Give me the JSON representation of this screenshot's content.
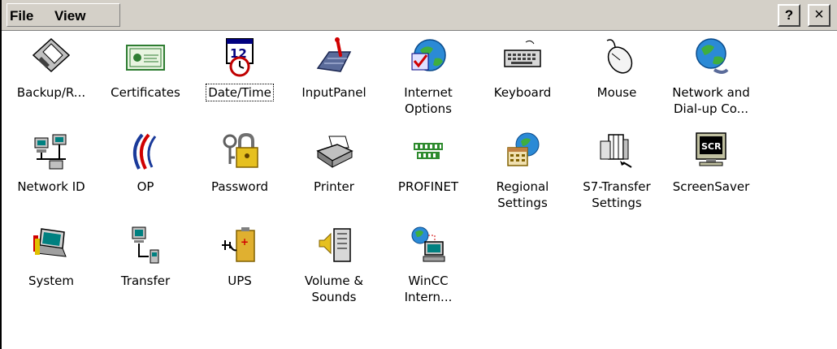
{
  "menubar": {
    "file": "File",
    "view": "View",
    "help": "?",
    "close": "×"
  },
  "items": [
    {
      "label": "Backup/R...",
      "icon": "floppy-disk-icon"
    },
    {
      "label": "Certificates",
      "icon": "certificate-icon"
    },
    {
      "label": "Date/Time",
      "icon": "calendar-clock-icon"
    },
    {
      "label": "InputPanel",
      "icon": "input-panel-keyboard-icon"
    },
    {
      "label": "Internet\nOptions",
      "icon": "globe-checkmark-icon"
    },
    {
      "label": "Keyboard",
      "icon": "keyboard-icon"
    },
    {
      "label": "Mouse",
      "icon": "mouse-icon"
    },
    {
      "label": "Network and\nDial-up Co...",
      "icon": "network-globe-icon"
    },
    {
      "label": "Network ID",
      "icon": "network-computers-icon"
    },
    {
      "label": "OP",
      "icon": "siemens-op-icon"
    },
    {
      "label": "Password",
      "icon": "keys-padlock-icon"
    },
    {
      "label": "Printer",
      "icon": "printer-icon"
    },
    {
      "label": "PROFINET",
      "icon": "profinet-icon"
    },
    {
      "label": "Regional\nSettings",
      "icon": "regional-calendar-globe-icon"
    },
    {
      "label": "S7-Transfer\nSettings",
      "icon": "s7-transfer-icon"
    },
    {
      "label": "ScreenSaver",
      "icon": "screensaver-monitor-icon"
    },
    {
      "label": "System",
      "icon": "laptop-system-icon"
    },
    {
      "label": "Transfer",
      "icon": "transfer-computer-device-icon"
    },
    {
      "label": "UPS",
      "icon": "ups-battery-icon"
    },
    {
      "label": "Volume &\nSounds",
      "icon": "speaker-icon"
    },
    {
      "label": "WinCC\nIntern...",
      "icon": "wincc-globe-computer-icon"
    }
  ],
  "focused_index": 2
}
